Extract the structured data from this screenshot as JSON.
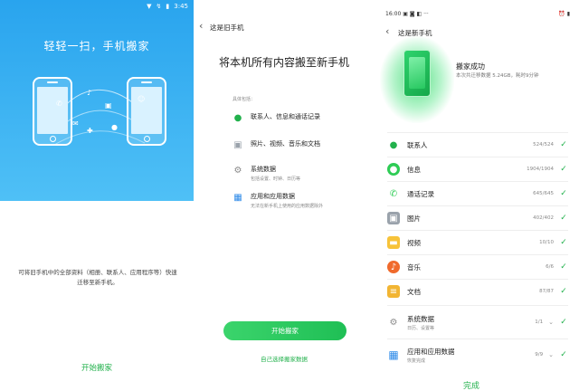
{
  "panel1": {
    "status_icons": [
      "▼",
      "↯",
      "▮"
    ],
    "time": "3:45",
    "hero_title": "轻轻一扫，手机搬家",
    "description": "可将旧手机中的全部资料（相册、联系人、应用程序等）快速迁移至新手机。",
    "start_label": "开始搬家"
  },
  "panel2": {
    "header": "这是旧手机",
    "big_title": "将本机所有内容搬至新手机",
    "includes_label": "具体包括：",
    "rows": [
      {
        "title": "联系人、信息和通话记录",
        "sub": ""
      },
      {
        "title": "照片、视频、音乐和文档",
        "sub": ""
      },
      {
        "title": "系统数据",
        "sub": "包括设置、时钟、日历等"
      },
      {
        "title": "应用和应用数据",
        "sub": "无法在新手机上使用的应用数据除外"
      }
    ],
    "cta": "开始搬家",
    "custom_link": "自己选择搬家数据"
  },
  "panel3": {
    "status_left": "16:00 ▣ ◙ ◧ ···",
    "status_right": "⏰ ▮",
    "header": "这是新手机",
    "done_title": "搬家成功",
    "done_sub": "本次共迁移数据 5.24GB，耗时9分钟",
    "items": [
      {
        "name": "联系人",
        "count": "524/524",
        "sub": "",
        "color": "#22b14c"
      },
      {
        "name": "信息",
        "count": "1904/1904",
        "sub": "",
        "color": "#2ecc55"
      },
      {
        "name": "通话记录",
        "count": "645/645",
        "sub": "",
        "color": "#2ecc55"
      },
      {
        "name": "图片",
        "count": "402/402",
        "sub": "",
        "color": "#9aa2ab"
      },
      {
        "name": "视频",
        "count": "10/10",
        "sub": "",
        "color": "#f7c33a"
      },
      {
        "name": "音乐",
        "count": "6/6",
        "sub": "",
        "color": "#f06a2c"
      },
      {
        "name": "文档",
        "count": "87/87",
        "sub": "",
        "color": "#f2b533"
      },
      {
        "name": "系统数据",
        "count": "1/1",
        "sub": "日历、设置等",
        "color": "#8c8c8c"
      },
      {
        "name": "应用和应用数据",
        "count": "9/9",
        "sub": "恢复完成",
        "color": "#2d8ae8"
      }
    ],
    "complete_label": "完成"
  },
  "colors": {
    "accent": "#22b14c",
    "hero_blue": "#29a4ee"
  }
}
